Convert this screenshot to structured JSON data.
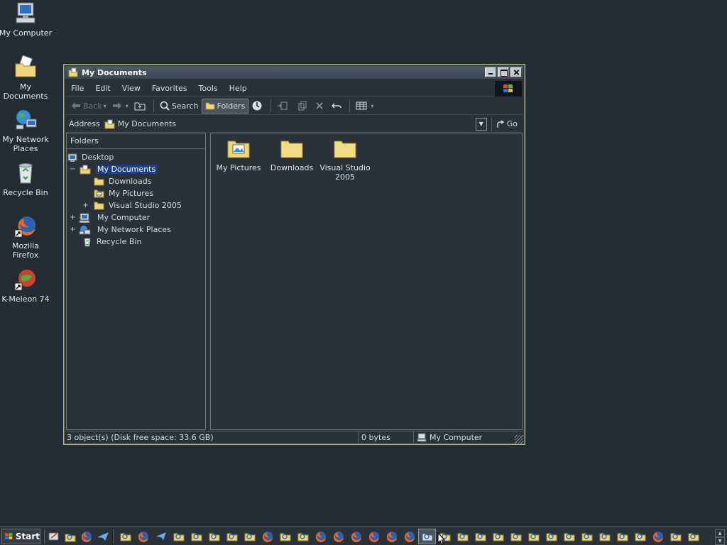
{
  "desktop": {
    "icons": [
      {
        "label": "My Computer",
        "icon": "computer-icon"
      },
      {
        "label": "My Documents",
        "icon": "documents-folder-icon"
      },
      {
        "label": "My Network Places",
        "icon": "network-icon"
      },
      {
        "label": "Recycle Bin",
        "icon": "recycle-bin-icon"
      },
      {
        "label": "Mozilla Firefox",
        "icon": "firefox-icon"
      },
      {
        "label": "K-Meleon 74",
        "icon": "kmeleon-icon"
      }
    ]
  },
  "window": {
    "title": "My Documents",
    "menu": [
      "File",
      "Edit",
      "View",
      "Favorites",
      "Tools",
      "Help"
    ],
    "toolbar": {
      "back": "Back",
      "search": "Search",
      "folders": "Folders"
    },
    "address": {
      "label": "Address",
      "value": "My Documents",
      "go": "Go"
    },
    "folders_pane": {
      "header": "Folders",
      "tree": [
        {
          "label": "Desktop",
          "expander": ""
        },
        {
          "label": "My Documents",
          "expander": "−",
          "selected": true
        },
        {
          "label": "Downloads",
          "expander": ""
        },
        {
          "label": "My Pictures",
          "expander": ""
        },
        {
          "label": "Visual Studio 2005",
          "expander": "+"
        },
        {
          "label": "My Computer",
          "expander": "+"
        },
        {
          "label": "My Network Places",
          "expander": "+"
        },
        {
          "label": "Recycle Bin",
          "expander": ""
        }
      ]
    },
    "content": {
      "items": [
        {
          "label": "My Pictures",
          "icon": "pictures-folder-icon"
        },
        {
          "label": "Downloads",
          "icon": "folder-icon"
        },
        {
          "label": "Visual Studio 2005",
          "icon": "folder-icon"
        }
      ]
    },
    "status": {
      "objects": "3 object(s) (Disk free space: 33.6 GB)",
      "size": "0 bytes",
      "location": "My Computer"
    }
  },
  "taskbar": {
    "start": "Start"
  }
}
